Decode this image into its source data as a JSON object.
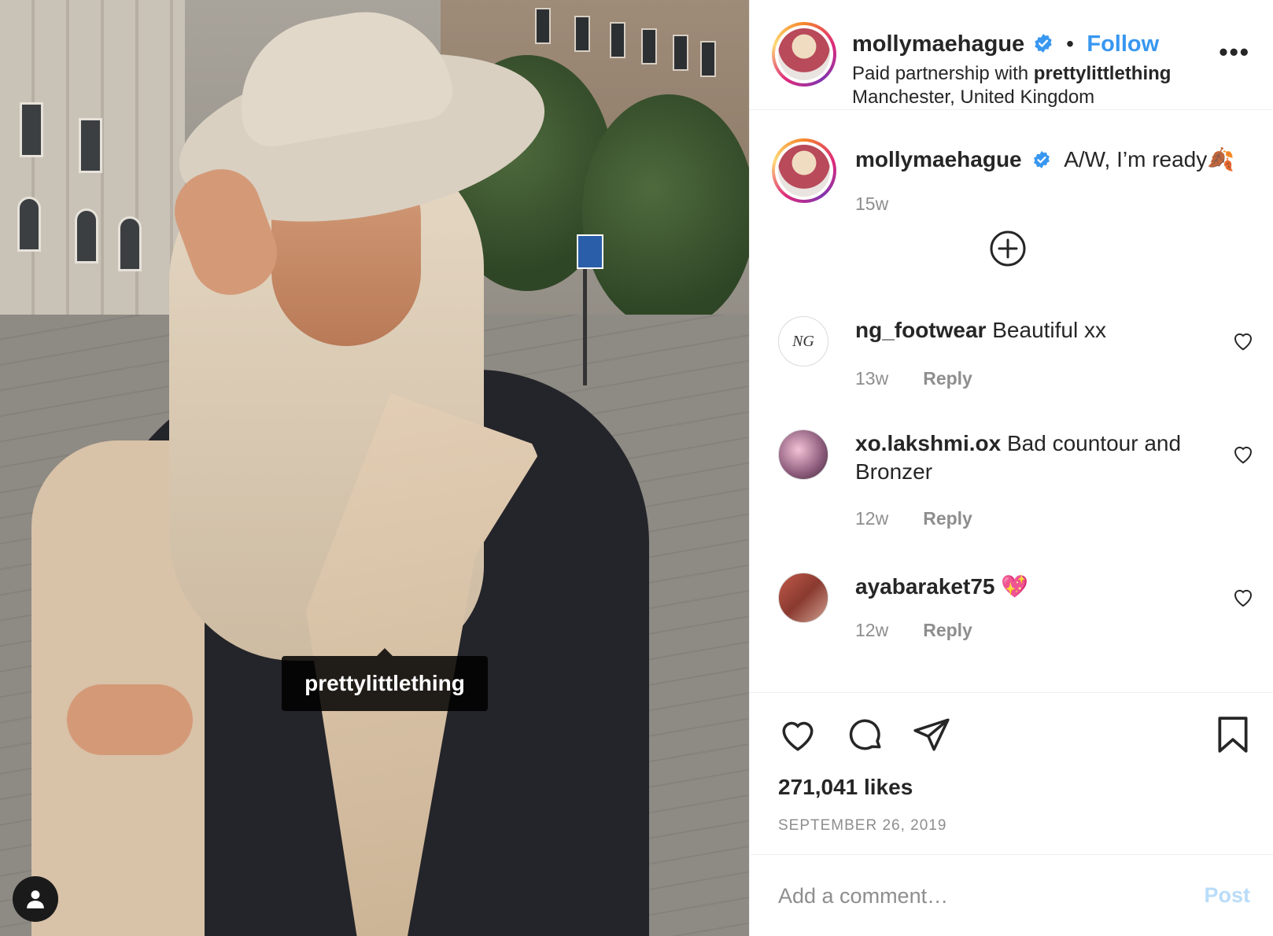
{
  "post": {
    "image_tag": "prettylittlething",
    "user_tags_icon": "user-icon"
  },
  "header": {
    "username": "mollymaehague",
    "separator": "•",
    "follow_label": "Follow",
    "partnership_prefix": "Paid partnership with ",
    "partner": "prettylittlething",
    "location": "Manchester, United Kingdom",
    "more_icon": "more-options-icon",
    "more_label": "•••"
  },
  "caption": {
    "username": "mollymaehague",
    "text": "A/W, I’m ready🍂",
    "age": "15w",
    "load_more_icon": "plus-circle-icon"
  },
  "comments": [
    {
      "username": "ng_footwear",
      "text": "Beautiful xx",
      "age": "13w",
      "reply": "Reply"
    },
    {
      "username": "xo.lakshmi.ox",
      "text": "Bad countour and Bronzer",
      "age": "12w",
      "reply": "Reply"
    },
    {
      "username": "ayabaraket75",
      "text": "💖",
      "age": "12w",
      "reply": "Reply"
    }
  ],
  "actions": {
    "likes": "271,041 likes",
    "date": "SEPTEMBER 26, 2019",
    "icons": [
      "heart-icon",
      "comment-icon",
      "share-icon",
      "bookmark-icon"
    ]
  },
  "add_comment": {
    "placeholder": "Add a comment…",
    "post_label": "Post"
  },
  "colors": {
    "accent": "#3897f0",
    "post_disabled": "#b9dcf9",
    "muted": "#8e8e8e",
    "text": "#262626"
  }
}
